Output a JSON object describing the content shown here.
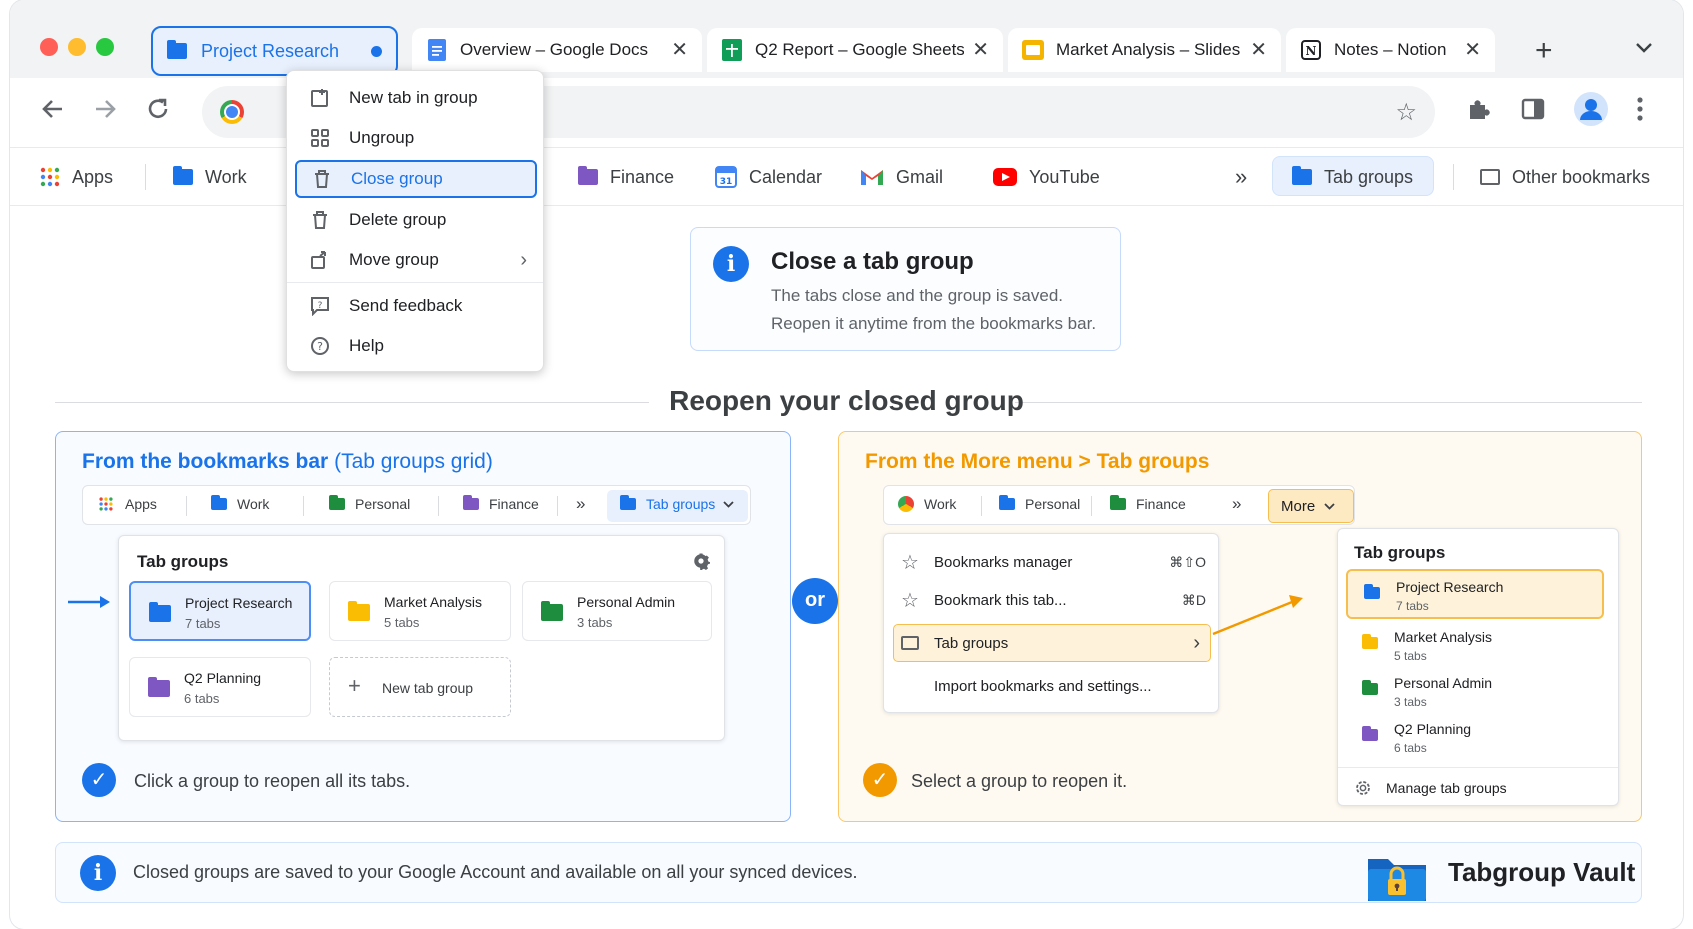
{
  "browser": {
    "tab_group": {
      "label": "Project Research",
      "color": "#1a73e8"
    },
    "tabs": [
      {
        "label": "Overview – Google Docs",
        "icon": "google-docs-icon"
      },
      {
        "label": "Q2 Report – Google Sheets",
        "icon": "google-sheets-icon"
      },
      {
        "label": "Market Analysis – Slides",
        "icon": "google-slides-icon"
      },
      {
        "label": "Notes – Notion",
        "icon": "notion-icon"
      }
    ],
    "new_tab_glyph": "+",
    "close_glyph": "✕"
  },
  "bookmarks": {
    "apps": "Apps",
    "work": "Work",
    "finance": "Finance",
    "calendar": "Calendar",
    "gmail": "Gmail",
    "youtube": "YouTube",
    "overflow": "»",
    "tab_groups": "Tab groups",
    "other": "Other bookmarks"
  },
  "context_menu": {
    "items": [
      {
        "label": "New tab in group",
        "icon": "new-tab-icon"
      },
      {
        "label": "Ungroup",
        "icon": "ungroup-icon"
      },
      {
        "label": "Close group",
        "icon": "trash-icon",
        "selected": true
      },
      {
        "label": "Delete group",
        "icon": "trash-icon"
      },
      {
        "label": "Move group",
        "icon": "move-icon",
        "submenu": true
      },
      {
        "label": "Send feedback",
        "icon": "feedback-icon"
      },
      {
        "label": "Help",
        "icon": "help-icon"
      }
    ]
  },
  "info": {
    "title": "Close a tab group",
    "line1": "The tabs close and the group is saved.",
    "line2": "Reopen it anytime from the bookmarks bar."
  },
  "section_title": "Reopen your closed group",
  "left_panel": {
    "title_main": "From the bookmarks bar",
    "title_sub": "(Tab groups grid)",
    "mini_bar": {
      "apps": "Apps",
      "work": "Work",
      "personal": "Personal",
      "finance": "Finance",
      "overflow": "»",
      "tab_groups": "Tab groups"
    },
    "card_title": "Tab groups",
    "groups": [
      {
        "name": "Project Research",
        "count": "7 tabs",
        "color": "#1a73e8"
      },
      {
        "name": "Market Analysis",
        "count": "5 tabs",
        "color": "#fbbc04"
      },
      {
        "name": "Personal Admin",
        "count": "3 tabs",
        "color": "#1e8e3e"
      },
      {
        "name": "Q2 Planning",
        "count": "6 tabs",
        "color": "#7e57c2"
      }
    ],
    "new_group": "New tab group",
    "tip": "Click a group to reopen all its tabs."
  },
  "or_label": "or",
  "right_panel": {
    "title": "From the More menu > Tab groups",
    "mini_bar": {
      "work": "Work",
      "personal": "Personal",
      "finance": "Finance",
      "overflow": "»",
      "more": "More"
    },
    "menu": [
      {
        "label": "Bookmarks manager",
        "shortcut": "⌘⇧O"
      },
      {
        "label": "Bookmark this tab...",
        "shortcut": "⌘D"
      },
      {
        "label": "Tab groups"
      },
      {
        "label": "Import bookmarks and settings..."
      }
    ],
    "submenu_title": "Tab groups",
    "groups": [
      {
        "name": "Project Research",
        "count": "7 tabs",
        "color": "#1a73e8"
      },
      {
        "name": "Market Analysis",
        "count": "5 tabs",
        "color": "#fbbc04"
      },
      {
        "name": "Personal Admin",
        "count": "3 tabs",
        "color": "#1e8e3e"
      },
      {
        "name": "Q2 Planning",
        "count": "6 tabs",
        "color": "#7e57c2"
      }
    ],
    "manage": "Manage tab groups",
    "tip": "Select a group to reopen it."
  },
  "footer": {
    "text": "Closed groups are saved to your Google Account and available on all your synced devices.",
    "brand": "Tabgroup Vault"
  },
  "colors": {
    "accent_blue": "#1a73e8",
    "accent_orange": "#f29900"
  }
}
